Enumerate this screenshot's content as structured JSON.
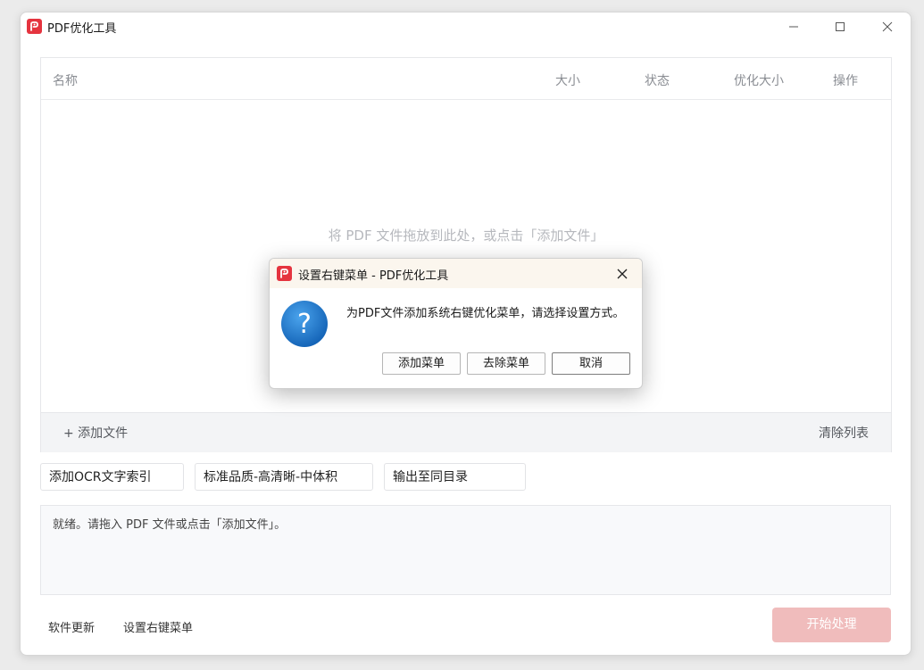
{
  "window": {
    "title": "PDF优化工具",
    "icons": {
      "logo": "pdf-logo-icon",
      "minimize": "minimize-icon",
      "maximize": "maximize-icon",
      "close": "close-icon"
    }
  },
  "list": {
    "columns": {
      "name": "名称",
      "size": "大小",
      "status": "状态",
      "optimized_size": "优化大小",
      "action": "操作"
    },
    "empty_hint": "将 PDF 文件拖放到此处，或点击「添加文件」",
    "add_file": "+ 添加文件",
    "clear_list": "清除列表"
  },
  "options": {
    "ocr": "添加OCR文字索引",
    "quality": "标准品质-高清晰-中体积",
    "output": "输出至同目录"
  },
  "log": {
    "text": "就绪。请拖入 PDF 文件或点击「添加文件」。"
  },
  "footer": {
    "software_update": "软件更新",
    "context_menu_setup": "设置右键菜单",
    "start": "开始处理"
  },
  "dialog": {
    "title": "设置右键菜单 - PDF优化工具",
    "message": "为PDF文件添加系统右键优化菜单，请选择设置方式。",
    "buttons": {
      "add": "添加菜单",
      "remove": "去除菜单",
      "cancel": "取消"
    },
    "icon": "question-icon"
  },
  "colors": {
    "brand_red": "#e5343f",
    "start_button_disabled": "#f0bcbc",
    "question_blue": "#1f7fd0",
    "dialog_title_bg": "#fbf6ee"
  }
}
